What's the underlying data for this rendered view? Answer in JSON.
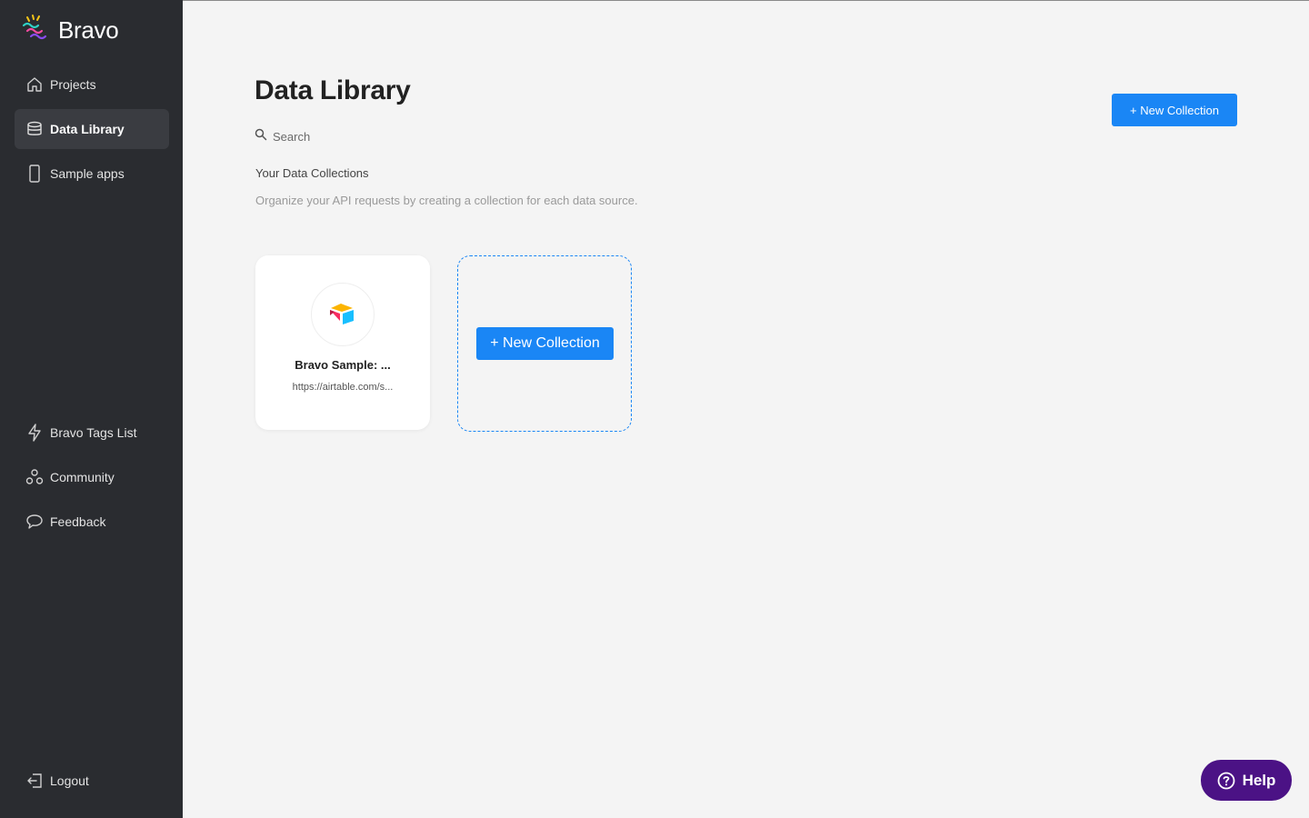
{
  "app": {
    "name": "Bravo"
  },
  "sidebar": {
    "items": [
      {
        "label": "Projects",
        "icon": "home-icon"
      },
      {
        "label": "Data Library",
        "icon": "database-icon",
        "active": true
      },
      {
        "label": "Sample apps",
        "icon": "phone-icon"
      }
    ],
    "bottom_items": [
      {
        "label": "Bravo Tags List",
        "icon": "lightning-icon"
      },
      {
        "label": "Community",
        "icon": "community-icon"
      },
      {
        "label": "Feedback",
        "icon": "chat-bubble-icon"
      }
    ],
    "logout_label": "Logout"
  },
  "main": {
    "title": "Data Library",
    "search": {
      "placeholder": "Search",
      "value": ""
    },
    "new_collection_label": "+ New Collection",
    "section_title": "Your Data Collections",
    "section_desc": "Organize your API requests by creating a collection for each data source.",
    "collections": [
      {
        "name": "Bravo Sample: ...",
        "url": "https://airtable.com/s...",
        "source_icon": "airtable-logo-icon"
      }
    ],
    "new_card_label": "+ New Collection"
  },
  "help": {
    "label": "Help"
  },
  "colors": {
    "sidebar_bg": "#2a2c30",
    "accent": "#1a86f5",
    "help_bg": "#4b1285",
    "page_bg": "#f4f4f4"
  }
}
